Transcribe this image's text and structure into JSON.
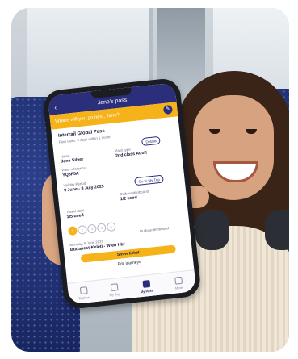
{
  "app": {
    "title": "Jane's pass",
    "banner": "Where will you go next, Jane?"
  },
  "pass": {
    "name_label": "Interrail Global Pass",
    "type_detail": "Flexi Pass: 5 days within 1 month",
    "details_button": "Details",
    "fields": {
      "name_label": "Name",
      "name_value": "Jane Silver",
      "pass_type_label": "Pass type",
      "pass_type_value": "2nd class Adult",
      "reference_label": "Pass reference",
      "reference_value": "YQ8F5A",
      "validity_label": "Validity Period",
      "validity_value": "9 June - 8 July 2025",
      "go_to_trip_button": "Go to My Trip",
      "travel_days_label": "Travel days",
      "travel_days_value": "1/5 used",
      "outbound_label": "Outbound/inbound",
      "outbound_value": "1/2 used"
    },
    "days": [
      "1",
      "2",
      "3",
      "4",
      "5"
    ],
    "days_used": 1,
    "journey": {
      "date": "Monday, 9 June 2025",
      "route": "Budapest-Keleti - Wien Hbf",
      "status": "Outbound/inbound"
    },
    "show_ticket_button": "Show ticket",
    "edit_journeys_link": "Edit journeys"
  },
  "tabs": [
    {
      "label": "Explore",
      "icon": "compass-icon"
    },
    {
      "label": "My Trip",
      "icon": "suitcase-icon"
    },
    {
      "label": "My Pass",
      "icon": "pass-icon",
      "active": true
    },
    {
      "label": "More",
      "icon": "menu-icon"
    }
  ],
  "colors": {
    "brand": "#2b2e7a",
    "accent": "#f5b219"
  }
}
